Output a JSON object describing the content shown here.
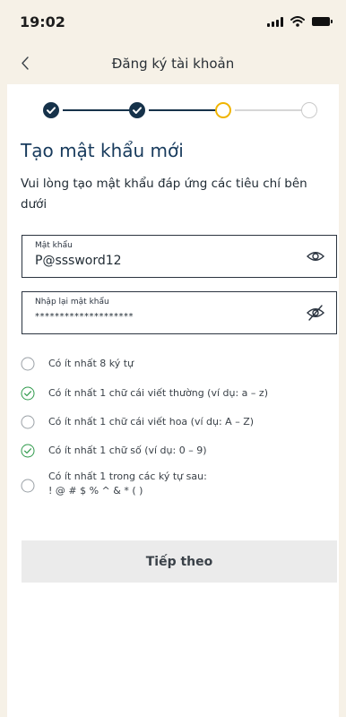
{
  "status_bar": {
    "time": "19:02"
  },
  "header": {
    "title": "Đăng ký tài khoản",
    "back_icon": "chevron-left-icon"
  },
  "stepper": {
    "steps": [
      "done",
      "done",
      "current",
      "todo"
    ],
    "colors": {
      "done": "#16324a",
      "current": "#f0b400",
      "todo": "#c9c9c9"
    }
  },
  "main": {
    "heading": "Tạo mật khẩu mới",
    "description": "Vui lòng tạo mật khẩu đáp ứng các tiêu chí bên dưới"
  },
  "form": {
    "password": {
      "label": "Mật khẩu",
      "value": "P@sssword12",
      "icon": "eye-icon"
    },
    "confirm_password": {
      "label": "Nhập lại mật khẩu",
      "value": "********************",
      "icon": "eye-off-icon"
    }
  },
  "criteria": [
    {
      "text": "Có ít nhất 8 ký tự",
      "met": false
    },
    {
      "text": "Có ít nhất 1 chữ cái viết thường (ví dụ: a – z)",
      "met": true
    },
    {
      "text": "Có ít nhất 1 chữ cái viết hoa (ví dụ: A – Z)",
      "met": false
    },
    {
      "text": "Có ít nhất 1 chữ số (ví dụ: 0 – 9)",
      "met": true
    },
    {
      "text": "Có ít nhất 1 trong các ký tự sau:",
      "text_line2": "! @ # $ % ^ & * ( )",
      "met": false
    }
  ],
  "actions": {
    "next_label": "Tiếp theo"
  },
  "colors": {
    "met": "#2f9a4b",
    "unmet": "#9aa0a6",
    "heading": "#173a5c",
    "background": "#f6f1e7"
  }
}
